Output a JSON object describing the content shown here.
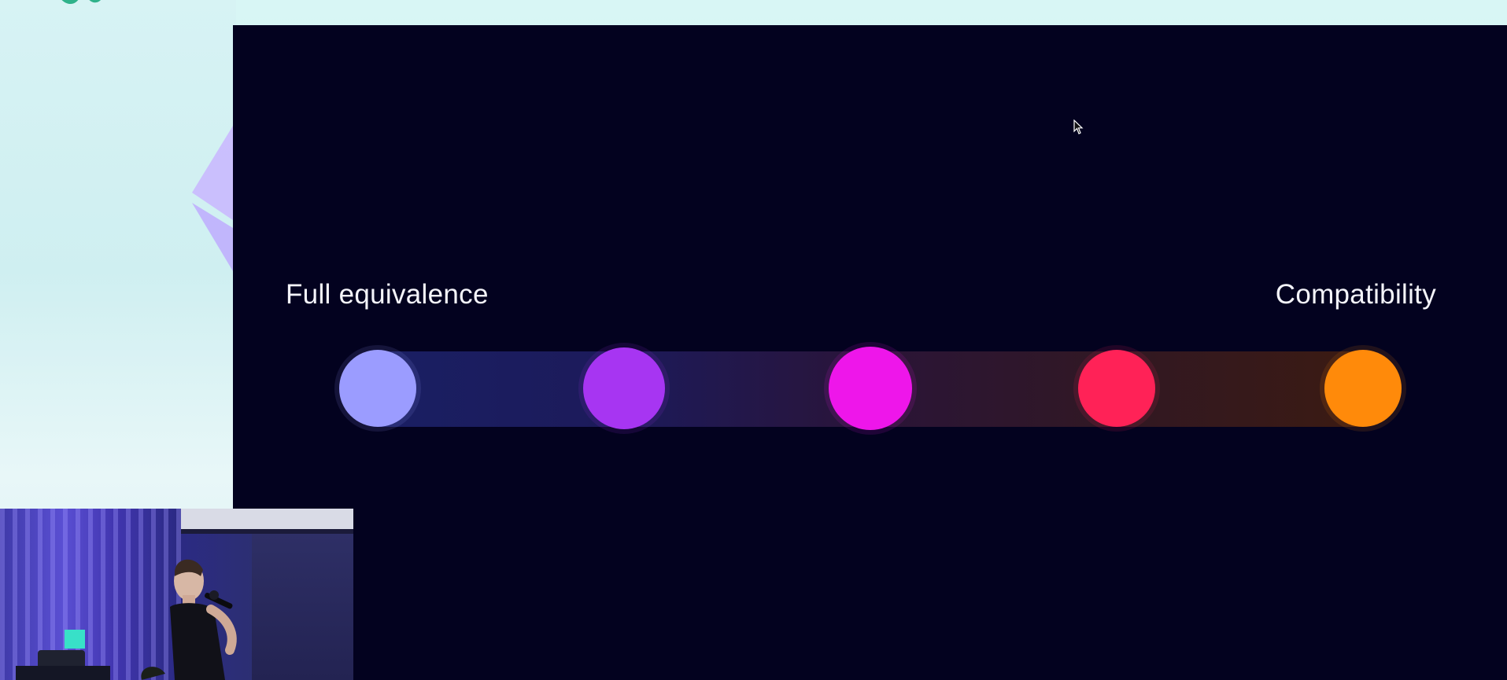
{
  "slide": {
    "label_left": "Full equivalence",
    "label_right": "Compatibility"
  },
  "spectrum": {
    "steps": [
      {
        "color": "#9b9cff"
      },
      {
        "color": "#a735f2"
      },
      {
        "color": "#ee16ea"
      },
      {
        "color": "#ff2257"
      },
      {
        "color": "#ff8a0a"
      }
    ]
  },
  "colors": {
    "slide_background": "#03021f",
    "template_background": "#d7f3f4",
    "label_text": "#f4f4fa"
  },
  "icons": {
    "cursor": "mouse-pointer-icon",
    "ethereum": "ethereum-diamond-icon"
  }
}
